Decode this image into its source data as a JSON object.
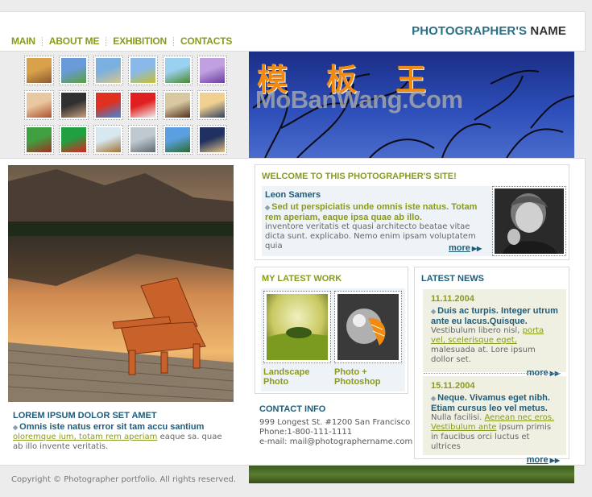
{
  "nav": {
    "items": [
      "MAIN",
      "ABOUT ME",
      "EXHIBITION",
      "CONTACTS"
    ]
  },
  "brand": {
    "part1": "PHOTOGRAPHER'S",
    "part2": "NAME"
  },
  "banner": {
    "chinese": "模板王",
    "watermark": "MoBanWang.Com"
  },
  "gallery": {
    "thumbs": [
      {
        "name": "chair-thumb",
        "colors": [
          "#d9a24a",
          "#8a5a30"
        ]
      },
      {
        "name": "field-thumb",
        "colors": [
          "#6a9ad8",
          "#5aa03a"
        ]
      },
      {
        "name": "beach-thumb",
        "colors": [
          "#7ab0e0",
          "#d9c68a"
        ]
      },
      {
        "name": "meadow-thumb",
        "colors": [
          "#8ab8e8",
          "#c8c030"
        ]
      },
      {
        "name": "hill-thumb",
        "colors": [
          "#9ad0f0",
          "#4a8a2a"
        ]
      },
      {
        "name": "flower-thumb",
        "colors": [
          "#c0a0e0",
          "#6a3aa0"
        ]
      },
      {
        "name": "girl-thumb",
        "colors": [
          "#e8c8a0",
          "#b05030"
        ]
      },
      {
        "name": "woman-thumb",
        "colors": [
          "#303030",
          "#c8a080"
        ]
      },
      {
        "name": "balloons-thumb",
        "colors": [
          "#e03020",
          "#3a8ae0"
        ]
      },
      {
        "name": "petals-thumb",
        "colors": [
          "#e02020",
          "#f0f0f0"
        ]
      },
      {
        "name": "shells-thumb",
        "colors": [
          "#d8c8a0",
          "#503020"
        ]
      },
      {
        "name": "sunset-thumb",
        "colors": [
          "#f0d090",
          "#304060"
        ]
      },
      {
        "name": "pinecone-thumb",
        "colors": [
          "#40a040",
          "#a03020"
        ]
      },
      {
        "name": "ornaments-thumb",
        "colors": [
          "#20a040",
          "#e02020"
        ]
      },
      {
        "name": "hay-thumb",
        "colors": [
          "#d8e8f0",
          "#a07030"
        ]
      },
      {
        "name": "church-thumb",
        "colors": [
          "#c0c8d0",
          "#606870"
        ]
      },
      {
        "name": "palm-thumb",
        "colors": [
          "#5aa0e0",
          "#2a6a2a"
        ]
      },
      {
        "name": "moon-thumb",
        "colors": [
          "#203060",
          "#e0c080"
        ]
      }
    ]
  },
  "lorem": {
    "title": "LOREM IPSUM DOLOR SET AMET",
    "lead": "Omnis iste natus error sit tam accu santium",
    "link": "oloremque ium, totam rem aperiam",
    "body_tail": " eaque sa. quae ab illo invente veritatis."
  },
  "welcome": {
    "title": "WELCOME TO THIS PHOTOGRAPHER'S SITE!",
    "name": "Leon Samers",
    "lead": "Sed ut perspiciatis unde omnis iste natus. Totam rem aperiam, eaque ipsa quae ab illo.",
    "body": "inventore veritatis et quasi architecto beatae vitae dicta sunt. explicabo. Nemo enim ipsam voluptatem quia",
    "more": "more"
  },
  "work": {
    "title": "MY LATEST WORK",
    "items": [
      {
        "caption": "Landscape Photo"
      },
      {
        "caption": "Photo + Photoshop"
      }
    ]
  },
  "contact": {
    "title": "CONTACT INFO",
    "address": "999 Longest St. #1200 San Francisco",
    "phone": "Phone:1-800-111-1111",
    "email": "e-mail: mail@photographername.com"
  },
  "news": {
    "title": "LATEST NEWS",
    "items": [
      {
        "date": "11.11.2004",
        "lead": "Duis ac turpis. Integer utrum ante eu lacus.Quisque.",
        "body_pre": "Vestibulum libero nisl, ",
        "link": "porta vel, scelerisque eget,",
        "body_post": " malesuada at. Lore ipsum dollor set.",
        "more": "more"
      },
      {
        "date": "15.11.2004",
        "lead": "Neque. Vivamus eget nibh. Etiam cursus leo vel metus.",
        "body_pre": "Nulla facilisi. ",
        "link": "Aenean nec eros. Vestibulum ante",
        "body_post": " ipsum primis in faucibus orci luctus et ultrices",
        "more": "more"
      }
    ]
  },
  "footer": {
    "copyright": "Copyright © Photographer portfolio. All rights reserved."
  }
}
